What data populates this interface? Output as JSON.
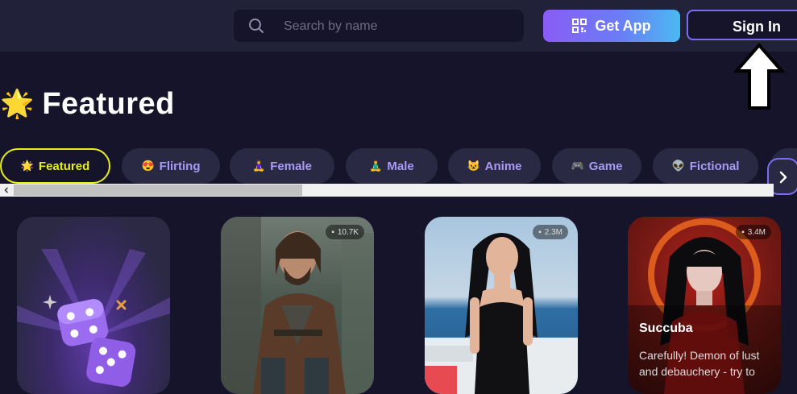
{
  "search": {
    "placeholder": "Search by name"
  },
  "header": {
    "get_app_label": "Get App",
    "sign_in_label": "Sign In"
  },
  "section": {
    "star": "🌟",
    "title": "Featured"
  },
  "categories": [
    {
      "icon": "🌟",
      "label": "Featured"
    },
    {
      "icon": "😍",
      "label": "Flirting"
    },
    {
      "icon": "🧘‍♀️",
      "label": "Female"
    },
    {
      "icon": "🧘‍♂️",
      "label": "Male"
    },
    {
      "icon": "😺",
      "label": "Anime"
    },
    {
      "icon": "🎮",
      "label": "Game"
    },
    {
      "icon": "👽",
      "label": "Fictional"
    }
  ],
  "cards": [
    {
      "type": "random"
    },
    {
      "count": "10.7K"
    },
    {
      "count": "2.3M"
    },
    {
      "count": "3.4M",
      "name": "Succuba",
      "desc": "Carefully! Demon of lust and debauchery - try to"
    }
  ],
  "colors": {
    "accent": "#7c6cf2",
    "active_chip": "#e6f016",
    "background": "#15142a",
    "topbar": "#22213a"
  }
}
